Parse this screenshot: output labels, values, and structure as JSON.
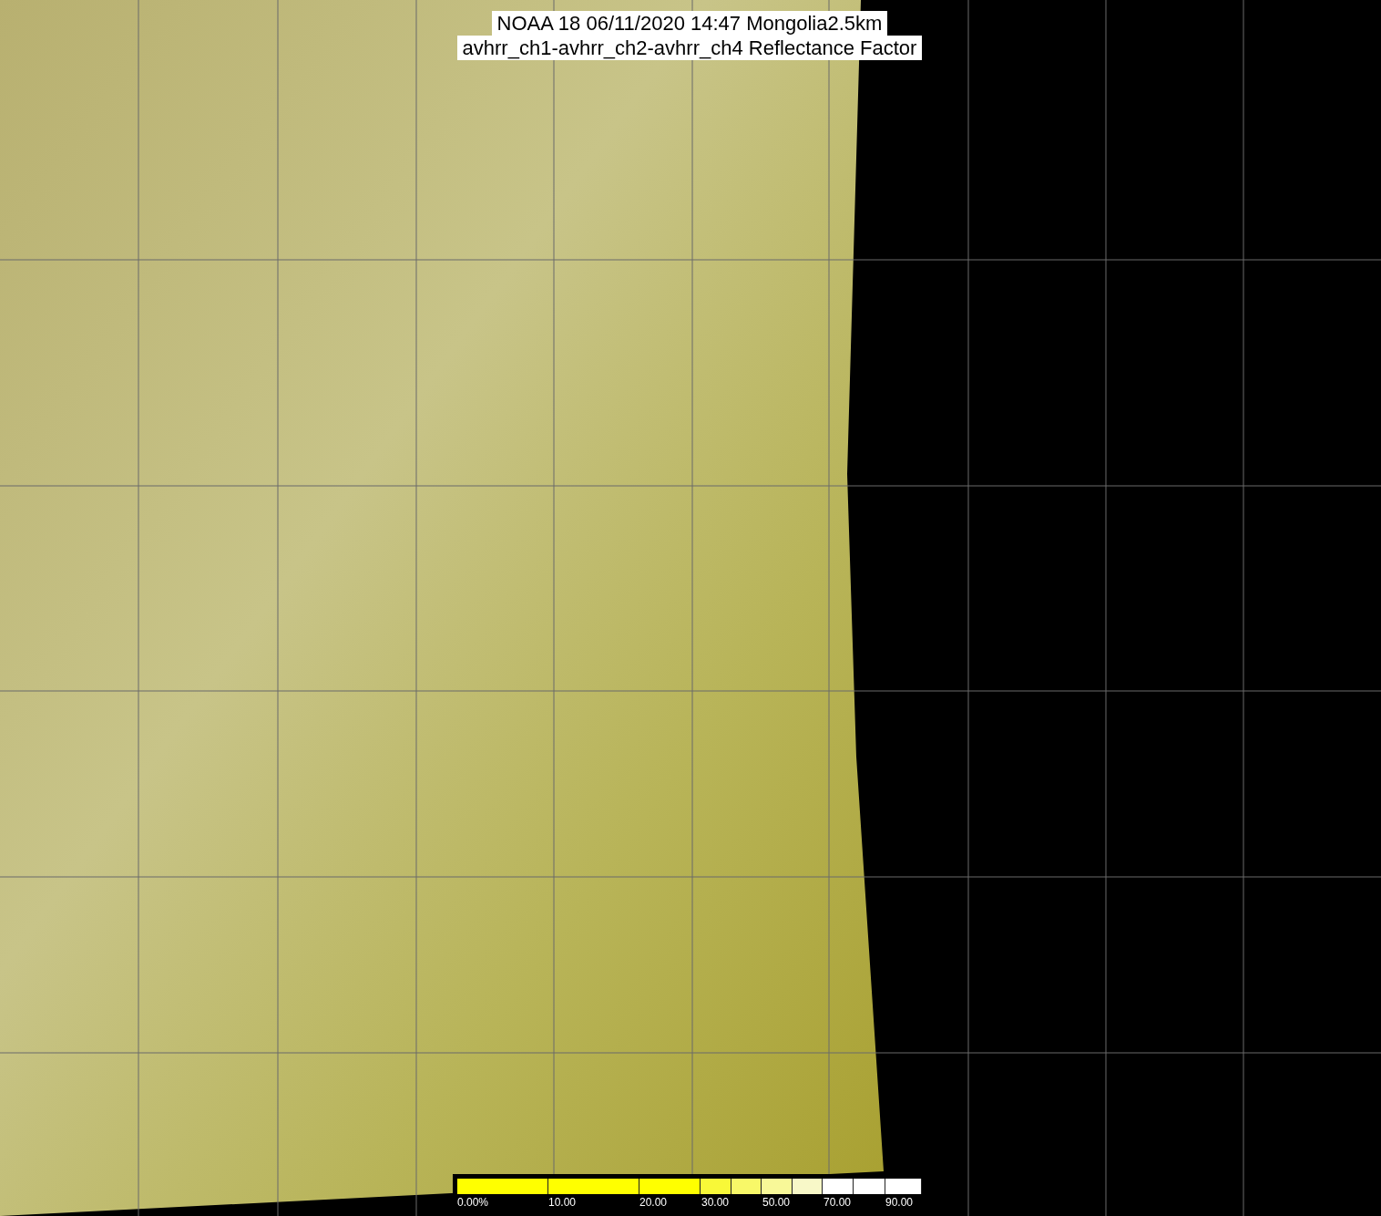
{
  "title_lines": [
    "NOAA 18 06/11/2020 14:47 Mongolia2.5km",
    "avhrr_ch1-avhrr_ch2-avhrr_ch4 Reflectance Factor"
  ],
  "colorbar": {
    "segments": [
      {
        "color": "#ffff00"
      },
      {
        "color": "#ffff00"
      },
      {
        "color": "#ffff00"
      },
      {
        "color": "#f8f838"
      },
      {
        "color": "#f8f868"
      },
      {
        "color": "#f8f898"
      },
      {
        "color": "#f8f8c8"
      },
      {
        "color": "#ffffff"
      },
      {
        "color": "#ffffff"
      },
      {
        "color": "#ffffff"
      }
    ],
    "tick_labels": [
      "0.00%",
      "10.00",
      "20.00",
      "30.00",
      "50.00",
      "70.00",
      "90.00"
    ]
  }
}
